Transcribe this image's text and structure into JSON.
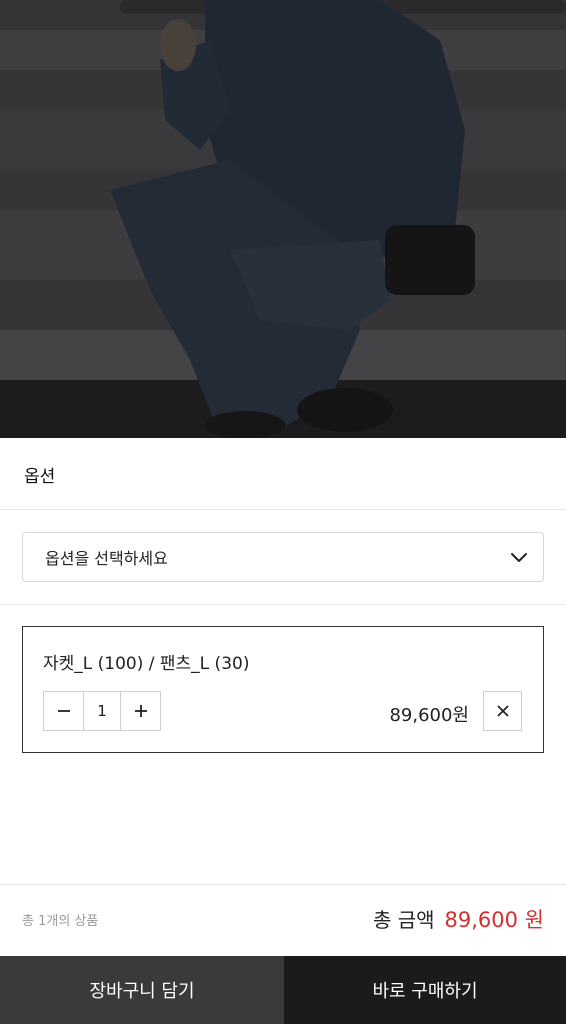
{
  "sheet": {
    "title": "옵션",
    "select_placeholder": "옵션을 선택하세요",
    "selected_item": {
      "name": "자켓_L (100) / 팬츠_L (30)",
      "quantity": "1",
      "price": "89,600원"
    },
    "summary": {
      "count_text": "총 1개의 상품",
      "total_label": "총 금액",
      "total_amount": "89,600 원"
    },
    "actions": {
      "cart_label": "장바구니 담기",
      "buy_label": "바로 구매하기"
    }
  },
  "icons": {
    "dropdown": "chevron-down-icon",
    "decrease": "minus-icon",
    "increase": "plus-icon",
    "remove": "close-icon"
  },
  "colors": {
    "total_amount": "#d32f2f",
    "cart_button_bg": "#3a3a3a",
    "buy_button_bg": "#1b1b1b"
  }
}
